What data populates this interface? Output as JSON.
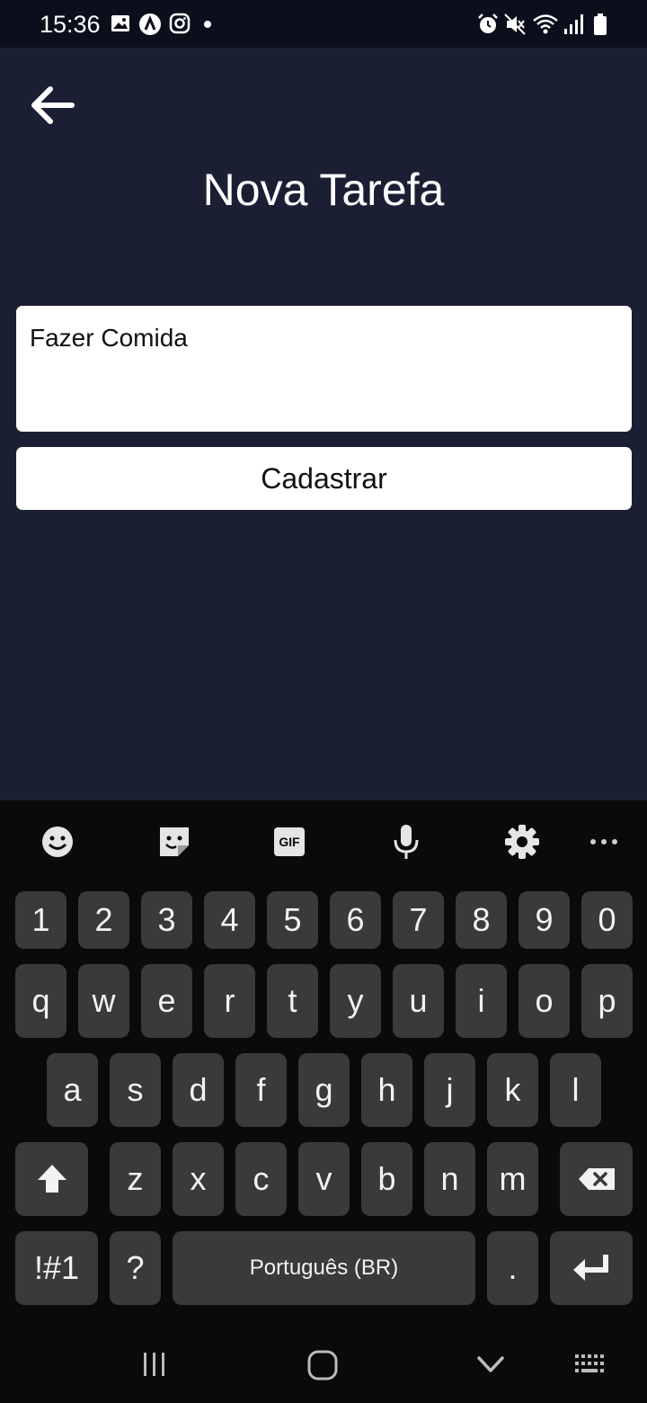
{
  "status_bar": {
    "time": "15:36",
    "left_icons": [
      "image-icon",
      "app-a-icon",
      "instagram-icon",
      "dot-icon"
    ],
    "right_icons": [
      "alarm-icon",
      "mute-icon",
      "wifi-icon",
      "signal-icon",
      "battery-icon"
    ]
  },
  "header": {
    "back_icon": "arrow-left-icon",
    "title": "Nova Tarefa"
  },
  "form": {
    "task_value": "Fazer Comida",
    "submit_label": "Cadastrar"
  },
  "keyboard": {
    "toolbar": [
      "emoji-icon",
      "sticker-icon",
      "gif-icon",
      "mic-icon",
      "settings-icon",
      "more-icon"
    ],
    "number_row": [
      "1",
      "2",
      "3",
      "4",
      "5",
      "6",
      "7",
      "8",
      "9",
      "0"
    ],
    "row1": [
      "q",
      "w",
      "e",
      "r",
      "t",
      "y",
      "u",
      "i",
      "o",
      "p"
    ],
    "row2": [
      "a",
      "s",
      "d",
      "f",
      "g",
      "h",
      "j",
      "k",
      "l"
    ],
    "row3": [
      "z",
      "x",
      "c",
      "v",
      "b",
      "n",
      "m"
    ],
    "symbols_label": "!#1",
    "question_label": "?",
    "space_label": "Português (BR)",
    "period_label": ".",
    "gif_label": "GIF"
  },
  "nav_bar": [
    "recents-icon",
    "home-icon",
    "hide-keyboard-icon",
    "keyboard-switch-icon"
  ],
  "colors": {
    "background": "#1b1f33",
    "status_bar": "#0c0f1b",
    "keyboard_bg": "#0a0a0a",
    "key_bg": "#3a3a3c"
  }
}
